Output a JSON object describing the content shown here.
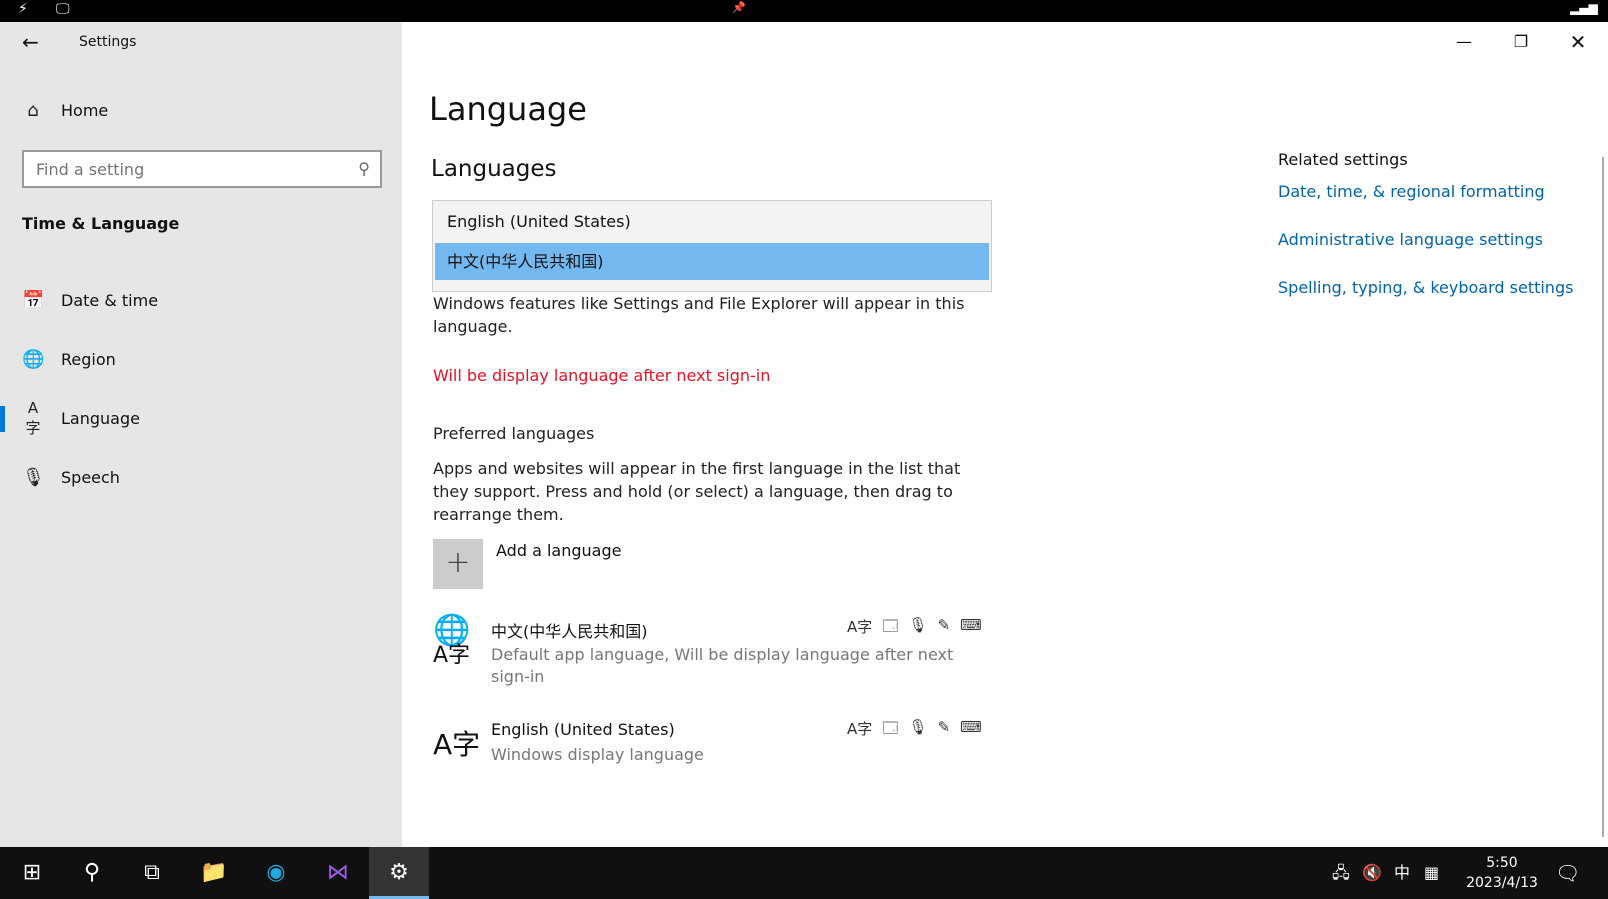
{
  "window": {
    "title": "Settings"
  },
  "sidebar": {
    "home_label": "Home",
    "search_placeholder": "Find a setting",
    "section_title": "Time & Language",
    "items": [
      {
        "label": "Date & time"
      },
      {
        "label": "Region"
      },
      {
        "label": "Language"
      },
      {
        "label": "Speech"
      }
    ]
  },
  "main": {
    "title": "Language",
    "languages_heading": "Languages",
    "display_language_options": [
      {
        "label": "English (United States)"
      },
      {
        "label": "中文(中华人民共和国)"
      }
    ],
    "display_description": "Windows features like Settings and File Explorer will appear in this language.",
    "warning": "Will be display language after next sign-in",
    "preferred_heading": "Preferred languages",
    "preferred_description": "Apps and websites will appear in the first language in the list that they support. Press and hold (or select) a language, then drag to rearrange them.",
    "add_language_label": "Add a language",
    "preferred_languages": [
      {
        "name": "中文(中华人民共和国)",
        "subtitle": "Default app language, Will be display language after next sign-in"
      },
      {
        "name": "English (United States)",
        "subtitle": "Windows display language"
      }
    ]
  },
  "related": {
    "heading": "Related settings",
    "links": [
      {
        "label": "Date, time, & regional formatting"
      },
      {
        "label": "Administrative language settings"
      },
      {
        "label": "Spelling, typing, & keyboard settings"
      }
    ]
  },
  "taskbar": {
    "tray_ime": "中",
    "clock_time": "5:50",
    "clock_date": "2023/4/13"
  },
  "colors": {
    "accent": "#0078d7",
    "selected_option": "#73b8ef",
    "warning": "#e81123",
    "link": "#0063b1"
  }
}
